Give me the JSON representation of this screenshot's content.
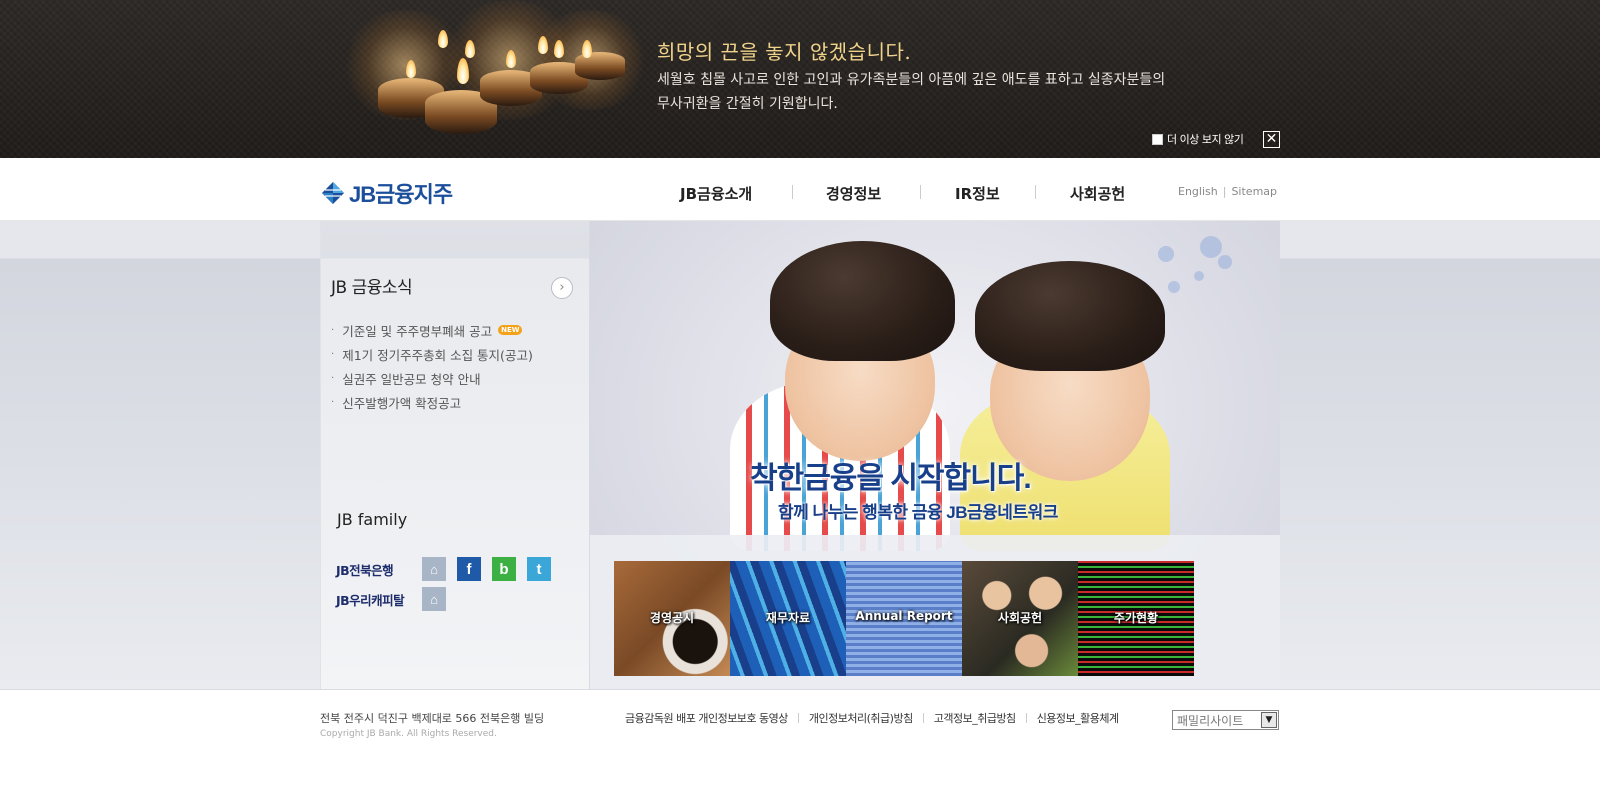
{
  "banner": {
    "title": "희망의 끈을 놓지 않겠습니다.",
    "line1": "세월호 침몰 사고로 인한 고인과 유가족분들의 아픔에 깊은 애도를 표하고 실종자분들의",
    "line2": "무사귀환을 간절히 기원합니다.",
    "dismiss_label": "더 이상 보지 않기",
    "close_glyph": "✕"
  },
  "header": {
    "logo_text": "JB금융지주",
    "nav": [
      "JB금융소개",
      "경영정보",
      "IR정보",
      "사회공헌"
    ],
    "util": [
      "English",
      "Sitemap"
    ]
  },
  "news": {
    "title": "JB 금융소식",
    "more_glyph": "›",
    "new_badge": "NEW",
    "items": [
      "기준일 및 주주명부폐쇄 공고",
      "제1기 정기주주총회 소집 통지(공고)",
      "실권주 일반공모 청약 안내",
      "신주발행가액 확정공고"
    ]
  },
  "family": {
    "title": "JB family",
    "rows": [
      {
        "name": "JB전북은행",
        "icons": [
          "home-icon",
          "facebook-icon",
          "blog-icon",
          "twitter-icon"
        ]
      },
      {
        "name": "JB우리캐피탈",
        "icons": [
          "home-icon"
        ]
      }
    ],
    "glyphs": {
      "home": "⌂",
      "facebook": "f",
      "blog": "b",
      "twitter": "t"
    }
  },
  "hero": {
    "headline": "착한금융을 시작합니다.",
    "subline": "함께 나누는 행복한 금융 JB금융네트워크"
  },
  "quick_links": [
    "경영공시",
    "재무자료",
    "Annual Report",
    "사회공헌",
    "주가현황"
  ],
  "footer": {
    "address": "전북 전주시 덕진구 백제대로 566 전북은행 빌딩",
    "copyright": "Copyright JB Bank. All Rights Reserved.",
    "links": [
      "금융감독원 배포 개인정보보호 동영상",
      "개인정보처리(취급)방침",
      "고객정보_취급방침",
      "신용정보_활용체계"
    ],
    "family_site": "패밀리사이트",
    "family_arrow": "▼"
  },
  "colors": {
    "brand_blue": "#1b4f9c",
    "banner_bg": "#231f1c",
    "banner_title": "#f0d38a",
    "new_badge": "#f4a21c"
  }
}
